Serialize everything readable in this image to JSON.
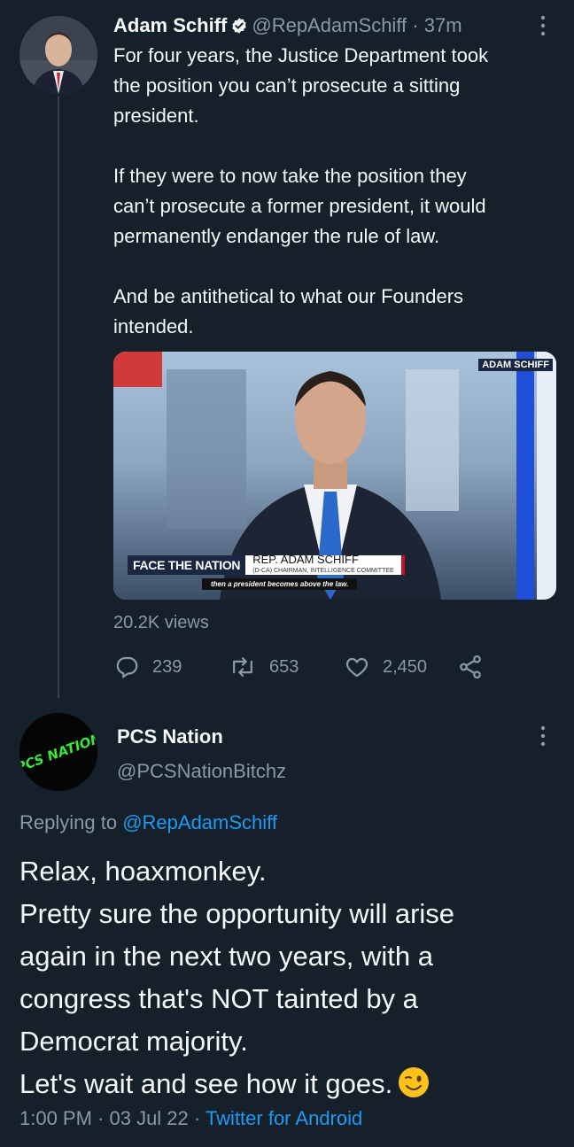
{
  "tweet": {
    "author_name": "Adam Schiff",
    "author_handle": "@RepAdamSchiff",
    "time_ago": "37m",
    "paragraphs": [
      "For four years, the Justice Department took\nthe position you can’t prosecute a sitting\npresident.",
      "If they were to now take the position they\ncan’t prosecute a former president, it would\npermanently endanger the rule of law.",
      "And be antithetical to what our Founders\nintended."
    ],
    "media": {
      "corner_logo": "ADAM SCHIFF",
      "show_brand": "FACE THE NATION",
      "nameplate_title": "REP. ADAM SCHIFF",
      "nameplate_subtitle": "(D-CA) CHAIRMAN, INTELLIGENCE COMMITTEE",
      "caption": "then a president becomes above the law."
    },
    "views": "20.2K views",
    "replies": "239",
    "retweets": "653",
    "likes": "2,450"
  },
  "reply": {
    "author_name": "PCS Nation",
    "author_handle": "@PCSNationBitchz",
    "avatar_text": "PCS NATION",
    "replying_prefix": "Replying to",
    "replying_handle": "@RepAdamSchiff",
    "lines": [
      "Relax, hoaxmonkey.",
      "Pretty sure the opportunity will arise",
      "again in the next two years, with a",
      "congress that's NOT tainted by a",
      "Democrat majority.",
      "Let's wait and see how it goes."
    ],
    "timestamp": "1:00 PM · 03 Jul 22 ·",
    "source": "Twitter for Android"
  },
  "colors": {
    "background": "#15202b",
    "text_primary": "#f7f9f9",
    "text_secondary": "#8b98a5",
    "link": "#1d9bf0",
    "verified": "#1d9bf0"
  },
  "icons": [
    "verified-badge-icon",
    "more-options-icon",
    "reply-icon",
    "retweet-icon",
    "like-icon",
    "share-icon",
    "winking-face-emoji-icon"
  ]
}
